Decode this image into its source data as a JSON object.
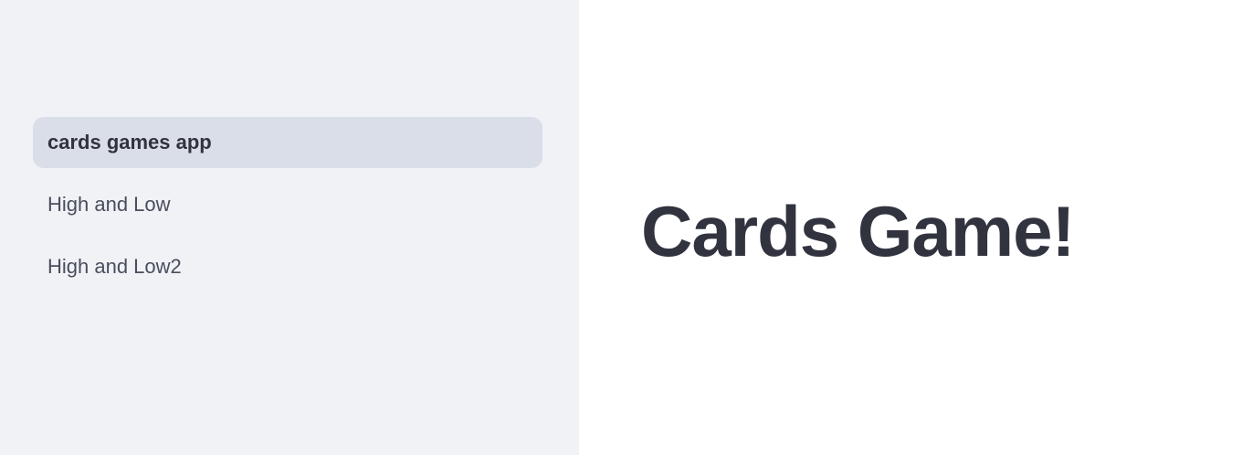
{
  "sidebar": {
    "items": [
      {
        "label": "cards games app",
        "active": true
      },
      {
        "label": "High and Low",
        "active": false
      },
      {
        "label": "High and Low2",
        "active": false
      }
    ]
  },
  "main": {
    "title": "Cards Game!"
  }
}
